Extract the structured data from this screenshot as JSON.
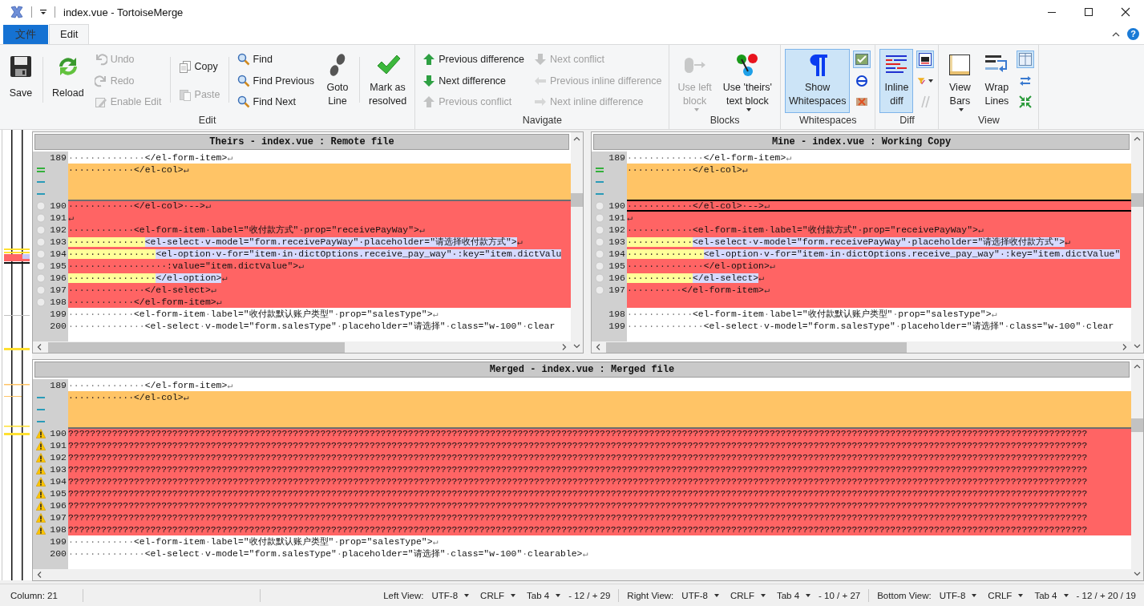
{
  "window": {
    "title": "index.vue - TortoiseMerge"
  },
  "ribbon": {
    "tabs": [
      {
        "label": "文件",
        "kind": "file",
        "selected": false
      },
      {
        "label": "Edit",
        "kind": "tab",
        "selected": true
      }
    ],
    "help": "?",
    "groups": [
      {
        "label": "Edit",
        "columns": [
          {
            "kind": "large",
            "divider": false,
            "items": [
              {
                "label": "Save",
                "disabled": false,
                "pressed": false,
                "dropdown": false
              }
            ]
          },
          {
            "kind": "large",
            "divider": true,
            "items": [
              {
                "label": "Reload",
                "disabled": false,
                "pressed": false,
                "dropdown": false
              }
            ]
          },
          {
            "kind": "small",
            "divider": false,
            "items": [
              {
                "label": "Undo",
                "disabled": true,
                "pressed": false,
                "dropdown": false
              },
              {
                "label": "Redo",
                "disabled": true,
                "pressed": false,
                "dropdown": false
              },
              {
                "label": "Enable Edit",
                "disabled": true,
                "pressed": false,
                "dropdown": false
              }
            ]
          },
          {
            "kind": "small",
            "divider": true,
            "items": [
              {
                "label": "Copy",
                "disabled": false,
                "pressed": false,
                "dropdown": false
              },
              {
                "label": "Paste",
                "disabled": true,
                "pressed": false,
                "dropdown": false
              }
            ]
          },
          {
            "kind": "small",
            "divider": true,
            "items": [
              {
                "label": "Find",
                "disabled": false,
                "pressed": false,
                "dropdown": false
              },
              {
                "label": "Find Previous",
                "disabled": false,
                "pressed": false,
                "dropdown": false
              },
              {
                "label": "Find Next",
                "disabled": false,
                "pressed": false,
                "dropdown": false
              }
            ]
          },
          {
            "kind": "large",
            "divider": false,
            "items": [
              {
                "label": "Goto\nLine",
                "disabled": false,
                "pressed": false,
                "dropdown": false
              }
            ]
          },
          {
            "kind": "large",
            "divider": true,
            "items": [
              {
                "label": "Mark as\nresolved",
                "disabled": false,
                "pressed": false,
                "dropdown": false
              }
            ]
          }
        ]
      },
      {
        "label": "Navigate",
        "columns": [
          {
            "kind": "small",
            "divider": false,
            "items": [
              {
                "label": "Previous difference",
                "disabled": false,
                "pressed": false,
                "dropdown": false
              },
              {
                "label": "Next difference",
                "disabled": false,
                "pressed": false,
                "dropdown": false
              },
              {
                "label": "Previous conflict",
                "disabled": true,
                "pressed": false,
                "dropdown": false
              }
            ]
          },
          {
            "kind": "small",
            "divider": false,
            "items": [
              {
                "label": "Next conflict",
                "disabled": true,
                "pressed": false,
                "dropdown": false
              },
              {
                "label": "Previous inline difference",
                "disabled": true,
                "pressed": false,
                "dropdown": false
              },
              {
                "label": "Next inline difference",
                "disabled": true,
                "pressed": false,
                "dropdown": false
              }
            ]
          }
        ]
      },
      {
        "label": "Blocks",
        "columns": [
          {
            "kind": "large",
            "divider": false,
            "items": [
              {
                "label": "Use left\nblock",
                "disabled": true,
                "pressed": false,
                "dropdown": true
              }
            ]
          },
          {
            "kind": "large",
            "divider": false,
            "items": [
              {
                "label": "Use 'theirs'\ntext block",
                "disabled": false,
                "pressed": false,
                "dropdown": true
              }
            ]
          }
        ]
      },
      {
        "label": "Whitespaces",
        "columns": [
          {
            "kind": "large",
            "divider": false,
            "items": [
              {
                "label": "Show\nWhitespaces",
                "disabled": false,
                "pressed": true,
                "dropdown": false
              }
            ]
          },
          {
            "kind": "icons",
            "divider": false,
            "items": [
              {
                "disabled": false,
                "pressed": true,
                "dropdown": false
              },
              {
                "disabled": false,
                "pressed": false,
                "dropdown": false
              },
              {
                "disabled": false,
                "pressed": false,
                "dropdown": false
              }
            ]
          }
        ]
      },
      {
        "label": "Diff",
        "columns": [
          {
            "kind": "large",
            "divider": false,
            "items": [
              {
                "label": "Inline\ndiff",
                "disabled": false,
                "pressed": true,
                "dropdown": false
              }
            ]
          },
          {
            "kind": "icons",
            "divider": false,
            "items": [
              {
                "disabled": false,
                "pressed": true,
                "dropdown": false
              },
              {
                "disabled": false,
                "pressed": false,
                "dropdown": true
              },
              {
                "disabled": true,
                "pressed": false,
                "dropdown": false
              }
            ]
          }
        ]
      },
      {
        "label": "View",
        "columns": [
          {
            "kind": "large",
            "divider": false,
            "items": [
              {
                "label": "View\nBars",
                "disabled": false,
                "pressed": false,
                "dropdown": true
              }
            ]
          },
          {
            "kind": "large",
            "divider": false,
            "items": [
              {
                "label": "Wrap\nLines",
                "disabled": false,
                "pressed": false,
                "dropdown": false
              }
            ]
          },
          {
            "kind": "icons",
            "divider": false,
            "items": [
              {
                "disabled": false,
                "pressed": true,
                "dropdown": false
              },
              {
                "disabled": false,
                "pressed": false,
                "dropdown": false
              },
              {
                "disabled": false,
                "pressed": false,
                "dropdown": false
              }
            ]
          }
        ]
      }
    ]
  },
  "panes": [
    {
      "title": "Theirs - index.vue : Remote file",
      "lines": [
        {
          "number": "189",
          "kind": "normal",
          "current": false,
          "segments": [
            {
              "text": "··············</el-form-item>↵",
              "kind": "plain"
            }
          ]
        },
        {
          "kind": "moved",
          "current": false,
          "segments": [
            {
              "text": "············</el-col>↵",
              "kind": "plain"
            }
          ]
        },
        {
          "kind": "removed",
          "current": false
        },
        {
          "kind": "removed",
          "current": false
        },
        {
          "number": "190",
          "kind": "conflict",
          "current": false,
          "segments": [
            {
              "text": "············</el-col>·-->↵",
              "kind": "plain"
            }
          ]
        },
        {
          "number": "191",
          "kind": "conflict",
          "current": false,
          "segments": [
            {
              "text": "↵",
              "kind": "plain"
            }
          ]
        },
        {
          "number": "192",
          "kind": "conflict",
          "current": false,
          "segments": [
            {
              "text": "············<el-form-item·label=\"收付款方式\"·prop=\"receivePayWay\">↵",
              "kind": "plain"
            }
          ]
        },
        {
          "number": "193",
          "kind": "conflict",
          "current": false,
          "segments": [
            {
              "text": "··············",
              "kind": "whitespace"
            },
            {
              "text": "<el-select·v-model=\"form.receivePayWay\"·placeholder=\"请选择收付款方式\">",
              "kind": "inline"
            },
            {
              "text": "↵",
              "kind": "plain"
            }
          ]
        },
        {
          "number": "194",
          "kind": "conflict",
          "current": false,
          "segments": [
            {
              "text": "················",
              "kind": "whitespace"
            },
            {
              "text": "<el-option·v-for=\"item·in·dictOptions.receive_pay_way\"·:key=\"item.dictValu",
              "kind": "inline"
            }
          ]
        },
        {
          "number": "195",
          "kind": "conflict",
          "current": false,
          "segments": [
            {
              "text": "··················:value=\"item.dictValue\">↵",
              "kind": "plain"
            }
          ]
        },
        {
          "number": "196",
          "kind": "conflict",
          "current": false,
          "segments": [
            {
              "text": "················",
              "kind": "whitespace"
            },
            {
              "text": "</el-option>",
              "kind": "inline"
            },
            {
              "text": "↵",
              "kind": "plain"
            }
          ]
        },
        {
          "number": "197",
          "kind": "conflict",
          "current": false,
          "segments": [
            {
              "text": "··············</el-select>↵",
              "kind": "plain"
            }
          ]
        },
        {
          "number": "198",
          "kind": "conflict",
          "current": false,
          "segments": [
            {
              "text": "············</el-form-item>↵",
              "kind": "plain"
            }
          ]
        },
        {
          "number": "199",
          "kind": "normal",
          "current": false,
          "segments": [
            {
              "text": "············<el-form-item·label=\"收付款默认账户类型\"·prop=\"salesType\">↵",
              "kind": "plain"
            }
          ]
        },
        {
          "number": "200",
          "kind": "normal",
          "current": false,
          "segments": [
            {
              "text": "··············<el-select·v-model=\"form.salesType\"·placeholder=\"请选择\"·class=\"w-100\"·clear",
              "kind": "plain"
            }
          ]
        }
      ]
    },
    {
      "title": "Mine - index.vue : Working Copy",
      "lines": [
        {
          "number": "189",
          "kind": "normal",
          "current": false,
          "segments": [
            {
              "text": "··············</el-form-item>↵",
              "kind": "plain"
            }
          ]
        },
        {
          "kind": "moved",
          "current": false,
          "segments": [
            {
              "text": "············</el-col>↵",
              "kind": "plain"
            }
          ]
        },
        {
          "kind": "removed",
          "current": false
        },
        {
          "kind": "removed",
          "current": false
        },
        {
          "number": "190",
          "kind": "conflict",
          "current": true,
          "segments": [
            {
              "text": "············</el-col>·-->↵",
              "kind": "plain"
            }
          ]
        },
        {
          "number": "191",
          "kind": "conflict",
          "current": false,
          "segments": [
            {
              "text": "↵",
              "kind": "plain"
            }
          ]
        },
        {
          "number": "192",
          "kind": "conflict",
          "current": false,
          "segments": [
            {
              "text": "············<el-form-item·label=\"收付款方式\"·prop=\"receivePayWay\">↵",
              "kind": "plain"
            }
          ]
        },
        {
          "number": "193",
          "kind": "conflict",
          "current": false,
          "segments": [
            {
              "text": "············",
              "kind": "whitespace"
            },
            {
              "text": "<el-select·v-model=\"form.receivePayWay\"·placeholder=\"请选择收付款方式\">",
              "kind": "inline"
            },
            {
              "text": "↵",
              "kind": "plain"
            }
          ]
        },
        {
          "number": "194",
          "kind": "conflict",
          "current": false,
          "segments": [
            {
              "text": "··············",
              "kind": "whitespace"
            },
            {
              "text": "<el-option·v-for=\"item·in·dictOptions.receive_pay_way\"·:key=\"item.dictValue\"",
              "kind": "inline"
            }
          ]
        },
        {
          "number": "195",
          "kind": "conflict",
          "current": false,
          "segments": [
            {
              "text": "··············</el-option>↵",
              "kind": "plain"
            }
          ]
        },
        {
          "number": "196",
          "kind": "conflict",
          "current": false,
          "segments": [
            {
              "text": "············",
              "kind": "whitespace"
            },
            {
              "text": "</el-select>",
              "kind": "inline"
            },
            {
              "text": "↵",
              "kind": "plain"
            }
          ]
        },
        {
          "number": "197",
          "kind": "conflict",
          "current": false,
          "segments": [
            {
              "text": "··········</el-form-item>↵",
              "kind": "plain"
            }
          ]
        },
        {
          "kind": "filler",
          "current": false
        },
        {
          "number": "198",
          "kind": "normal",
          "current": false,
          "segments": [
            {
              "text": "············<el-form-item·label=\"收付款默认账户类型\"·prop=\"salesType\">↵",
              "kind": "plain"
            }
          ]
        },
        {
          "number": "199",
          "kind": "normal",
          "current": false,
          "segments": [
            {
              "text": "··············<el-select·v-model=\"form.salesType\"·placeholder=\"请选择\"·class=\"w-100\"·clear",
              "kind": "plain"
            }
          ]
        }
      ]
    },
    {
      "title": "Merged - index.vue : Merged file",
      "lines": [
        {
          "number": "189",
          "kind": "normal",
          "current": false,
          "segments": [
            {
              "text": "··············</el-form-item>↵",
              "kind": "plain"
            }
          ]
        },
        {
          "kind": "removed",
          "current": false,
          "segments": [
            {
              "text": "············</el-col>↵",
              "kind": "plain"
            }
          ]
        },
        {
          "kind": "removed",
          "current": false
        },
        {
          "kind": "removed",
          "current": false
        },
        {
          "number": "190",
          "kind": "unresolved",
          "current": false,
          "segments": [
            {
              "text": "??????????????????????????????????????????????????????????????????????????????????????????????????????????????????????????????????????????????????????????????????????????????????????????",
              "kind": "plain"
            }
          ]
        },
        {
          "number": "191",
          "kind": "unresolved",
          "current": false,
          "segments": [
            {
              "text": "??????????????????????????????????????????????????????????????????????????????????????????????????????????????????????????????????????????????????????????????????????????????????????????",
              "kind": "plain"
            }
          ]
        },
        {
          "number": "192",
          "kind": "unresolved",
          "current": false,
          "segments": [
            {
              "text": "??????????????????????????????????????????????????????????????????????????????????????????????????????????????????????????????????????????????????????????????????????????????????????????",
              "kind": "plain"
            }
          ]
        },
        {
          "number": "193",
          "kind": "unresolved",
          "current": false,
          "segments": [
            {
              "text": "??????????????????????????????????????????????????????????????????????????????????????????????????????????????????????????????????????????????????????????????????????????????????????????",
              "kind": "plain"
            }
          ]
        },
        {
          "number": "194",
          "kind": "unresolved",
          "current": false,
          "segments": [
            {
              "text": "??????????????????????????????????????????????????????????????????????????????????????????????????????????????????????????????????????????????????????????????????????????????????????????",
              "kind": "plain"
            }
          ]
        },
        {
          "number": "195",
          "kind": "unresolved",
          "current": false,
          "segments": [
            {
              "text": "??????????????????????????????????????????????????????????????????????????????????????????????????????????????????????????????????????????????????????????????????????????????????????????",
              "kind": "plain"
            }
          ]
        },
        {
          "number": "196",
          "kind": "unresolved",
          "current": false,
          "segments": [
            {
              "text": "??????????????????????????????????????????????????????????????????????????????????????????????????????????????????????????????????????????????????????????????????????????????????????????",
              "kind": "plain"
            }
          ]
        },
        {
          "number": "197",
          "kind": "unresolved",
          "current": false,
          "segments": [
            {
              "text": "??????????????????????????????????????????????????????????????????????????????????????????????????????????????????????????????????????????????????????????????????????????????????????????",
              "kind": "plain"
            }
          ]
        },
        {
          "number": "198",
          "kind": "unresolved",
          "current": false,
          "segments": [
            {
              "text": "??????????????????????????????????????????????????????????????????????????????????????????????????????????????????????????????????????????????????????????????????????????????????????????",
              "kind": "plain"
            }
          ]
        },
        {
          "number": "199",
          "kind": "normal",
          "current": false,
          "segments": [
            {
              "text": "············<el-form-item·label=\"收付款默认账户类型\"·prop=\"salesType\">↵",
              "kind": "plain"
            }
          ]
        },
        {
          "number": "200",
          "kind": "normal",
          "current": false,
          "segments": [
            {
              "text": "··············<el-select·v-model=\"form.salesType\"·placeholder=\"请选择\"·class=\"w-100\"·clearable>↵",
              "kind": "plain"
            }
          ]
        }
      ]
    }
  ],
  "status_bar": {
    "column": "Column: 21",
    "views": [
      {
        "label": "Left View:",
        "encoding": "UTF-8",
        "eol": "CRLF",
        "tab": "Tab 4",
        "changes": "- 12 / + 29"
      },
      {
        "label": "Right View:",
        "encoding": "UTF-8",
        "eol": "CRLF",
        "tab": "Tab 4",
        "changes": "- 10 / + 27"
      },
      {
        "label": "Bottom View:",
        "encoding": "UTF-8",
        "eol": "CRLF",
        "tab": "Tab 4",
        "changes": "- 12 / + 20 / 19"
      }
    ]
  }
}
